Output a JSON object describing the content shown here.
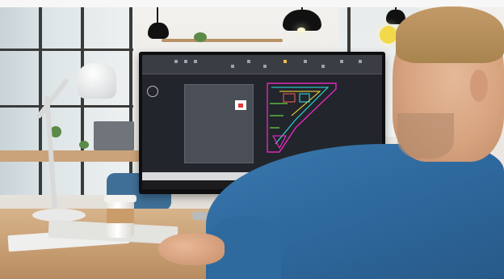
{
  "scene": {
    "description_hidden": "",
    "colors": {
      "shirt": "#2f6a9f",
      "desk": "#c79e73",
      "screen_bg": "#22252b"
    }
  },
  "cad_drawing": {
    "colors": [
      "#ff2bd6",
      "#2ee6e6",
      "#ffe23a",
      "#7cff4a",
      "#ff5a5a"
    ]
  }
}
